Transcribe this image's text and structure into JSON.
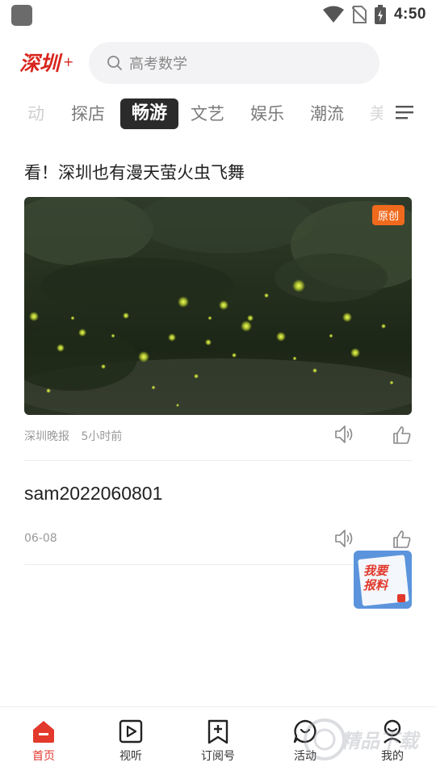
{
  "status_bar": {
    "time": "4:50",
    "icons": [
      "wifi-icon",
      "no-sim-icon",
      "battery-icon"
    ]
  },
  "header": {
    "logo_text": "深圳+",
    "search_placeholder": "高考数学",
    "brand_color": "#d8251d"
  },
  "tabs": {
    "items": [
      {
        "label": "动"
      },
      {
        "label": "探店"
      },
      {
        "label": "畅游",
        "active": true
      },
      {
        "label": "文艺"
      },
      {
        "label": "娱乐"
      },
      {
        "label": "潮流"
      },
      {
        "label": "美"
      }
    ]
  },
  "articles": [
    {
      "title": "看！深圳也有漫天萤火虫飞舞",
      "badge": "原创",
      "source": "深圳晚报",
      "time": "5小时前"
    },
    {
      "title": "sam2022060801",
      "date": "06-08"
    }
  ],
  "float_button": {
    "line1": "我要",
    "line2": "报料"
  },
  "bottom_nav": {
    "items": [
      {
        "label": "首页",
        "icon": "home-icon",
        "active": true
      },
      {
        "label": "视听",
        "icon": "play-icon"
      },
      {
        "label": "订阅号",
        "icon": "subscribe-icon"
      },
      {
        "label": "活动",
        "icon": "activity-icon"
      },
      {
        "label": "我的",
        "icon": "profile-icon"
      }
    ],
    "active_color": "#e2392c"
  },
  "watermark": "精品下载"
}
